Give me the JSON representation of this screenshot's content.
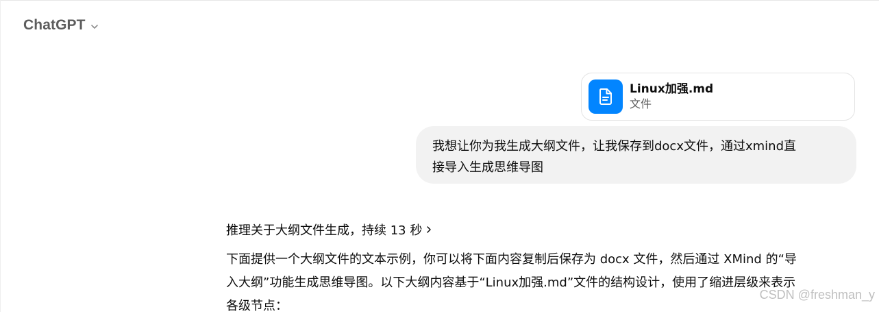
{
  "header": {
    "model_name": "ChatGPT"
  },
  "attachment": {
    "file_name": "Linux加强.md",
    "file_type": "文件",
    "icon": "document-icon",
    "icon_color": "#0285ff"
  },
  "user_message": {
    "line1": "我想让你为我生成大纲文件，让我保存到docx文件，通过xmind直",
    "line2": "接导入生成思维导图"
  },
  "assistant": {
    "reasoning_label": "推理关于大纲文件生成，持续 13 秒",
    "line1": "下面提供一个大纲文件的文本示例，你可以将下面内容复制后保存为 docx 文件，然后通过 XMind 的“导",
    "line2": "入大纲”功能生成思维导图。以下大纲内容基于“Linux加强.md”文件的结构设计，使用了缩进层级来表示",
    "line3": "各级节点："
  },
  "watermark": "CSDN @freshman_y"
}
